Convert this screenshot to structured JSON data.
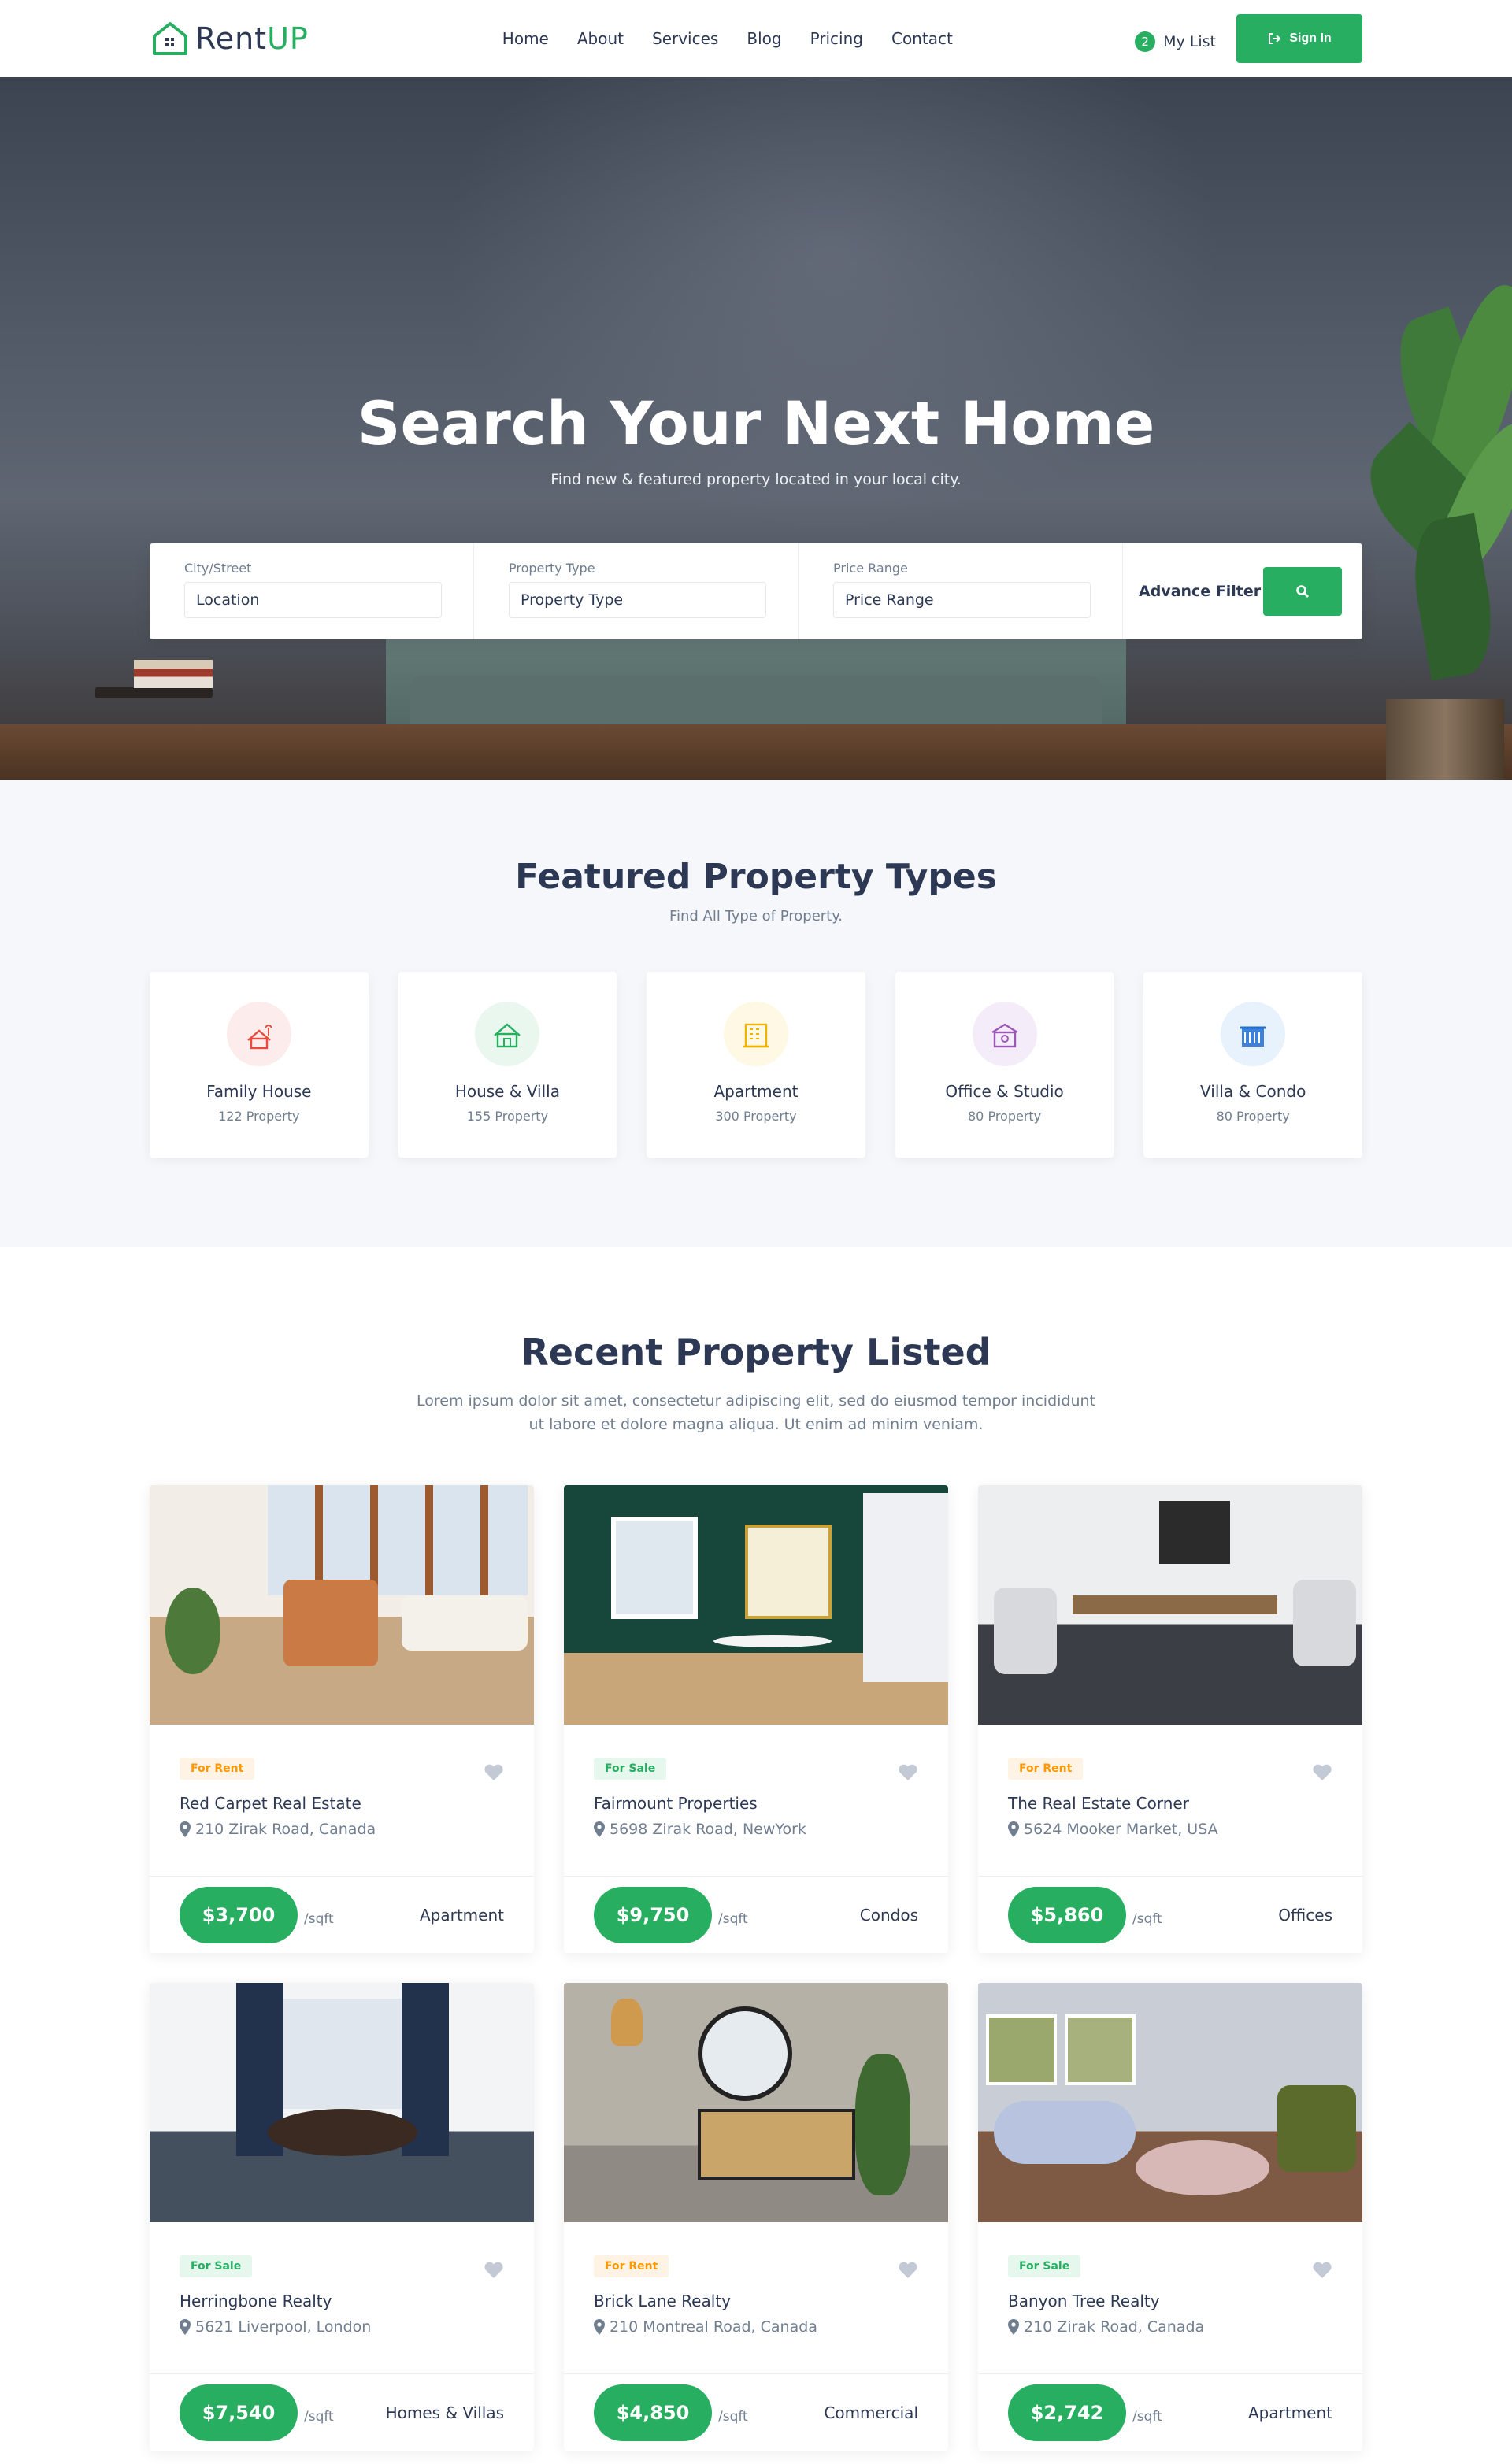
{
  "brand": {
    "name_a": "Rent",
    "name_b": "UP",
    "primary": "#27ae60",
    "text": "#2d3954"
  },
  "nav": [
    "Home",
    "About",
    "Services",
    "Blog",
    "Pricing",
    "Contact"
  ],
  "header": {
    "list_count": "2",
    "list_label": "My List",
    "signin_label": "Sign In"
  },
  "hero": {
    "title": "Search Your Next Home",
    "subtitle": "Find new & featured property located in your local city.",
    "search": {
      "city_label": "City/Street",
      "city_value": "Location",
      "type_label": "Property Type",
      "type_value": "Property Type",
      "price_label": "Price Range",
      "price_value": "Price Range",
      "advance_label": "Advance Filter",
      "search_icon": "search-icon"
    }
  },
  "featured": {
    "title": "Featured Property Types",
    "subtitle": "Find All Type of Property.",
    "types": [
      {
        "name": "Family House",
        "count": "122 Property",
        "icon": "family-house-icon",
        "color": "#e74c3c",
        "bg": "#fdecec"
      },
      {
        "name": "House & Villa",
        "count": "155 Property",
        "icon": "house-villa-icon",
        "color": "#27ae60",
        "bg": "#eaf7ef"
      },
      {
        "name": "Apartment",
        "count": "300 Property",
        "icon": "apartment-icon",
        "color": "#f0b400",
        "bg": "#fff8e5"
      },
      {
        "name": "Office & Studio",
        "count": "80 Property",
        "icon": "office-studio-icon",
        "color": "#9b59b6",
        "bg": "#f5ecf9"
      },
      {
        "name": "Villa & Condo",
        "count": "80 Property",
        "icon": "villa-condo-icon",
        "color": "#1f6fd1",
        "bg": "#e8f2fc"
      }
    ]
  },
  "recent": {
    "title": "Recent Property Listed",
    "subtitle_line1": "Lorem ipsum dolor sit amet, consectetur adipiscing elit, sed do eiusmod tempor incididunt",
    "subtitle_line2": "ut labore et dolore magna aliqua. Ut enim ad minim veniam.",
    "unit": "/sqft",
    "listings": [
      {
        "tag": "For Rent",
        "kind": "rent",
        "name": "Red Carpet Real Estate",
        "address": "210 Zirak Road, Canada",
        "price": "$3,700",
        "type": "Apartment"
      },
      {
        "tag": "For Sale",
        "kind": "sale",
        "name": "Fairmount Properties",
        "address": "5698 Zirak Road, NewYork",
        "price": "$9,750",
        "type": "Condos"
      },
      {
        "tag": "For Rent",
        "kind": "rent",
        "name": "The Real Estate Corner",
        "address": "5624 Mooker Market, USA",
        "price": "$5,860",
        "type": "Offices"
      },
      {
        "tag": "For Sale",
        "kind": "sale",
        "name": "Herringbone Realty",
        "address": "5621 Liverpool, London",
        "price": "$7,540",
        "type": "Homes & Villas"
      },
      {
        "tag": "For Rent",
        "kind": "rent",
        "name": "Brick Lane Realty",
        "address": "210 Montreal Road, Canada",
        "price": "$4,850",
        "type": "Commercial"
      },
      {
        "tag": "For Sale",
        "kind": "sale",
        "name": "Banyon Tree Realty",
        "address": "210 Zirak Road, Canada",
        "price": "$2,742",
        "type": "Apartment"
      }
    ]
  }
}
